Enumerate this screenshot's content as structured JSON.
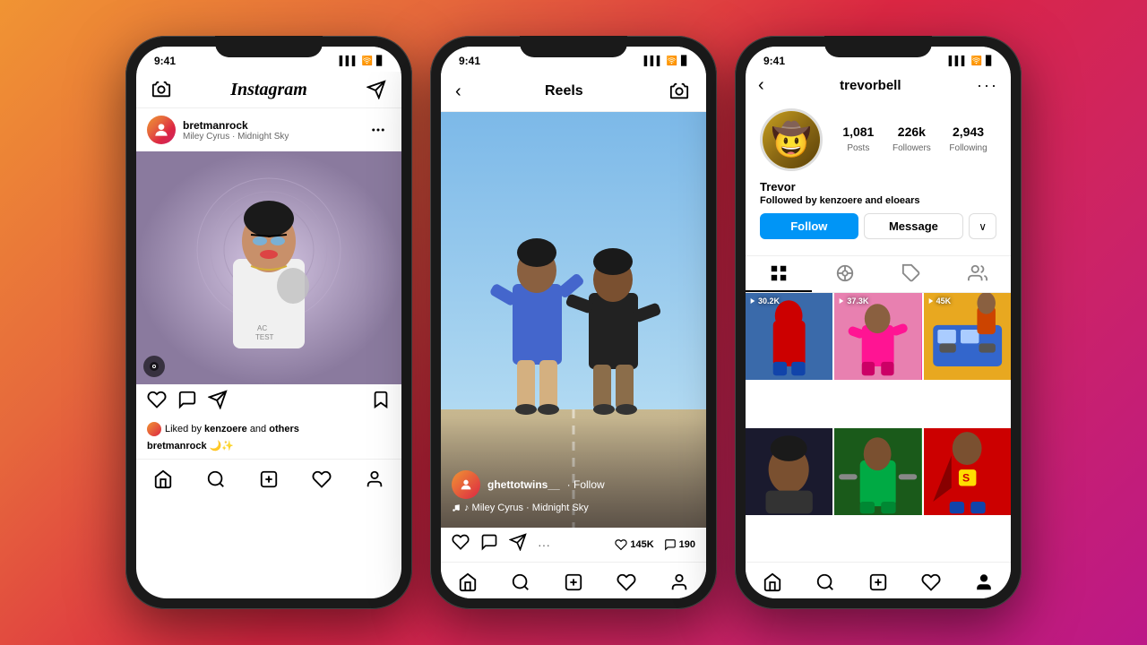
{
  "phone1": {
    "statusTime": "9:41",
    "header": {
      "logo": "Instagram",
      "cameraIcon": "📷",
      "sendIcon": "✈"
    },
    "post": {
      "username": "bretmanrock",
      "subtitle": "Miley Cyrus · Midnight Sky",
      "moreIcon": "···",
      "musicBadge": "♪",
      "likedBy": "Liked by",
      "likedByUser": "kenzoere",
      "likedByAnd": "and",
      "likedByOthers": "others",
      "caption": "bretmanrock",
      "captionEmoji": "🌙✨"
    },
    "nav": [
      "🏠",
      "🔍",
      "➕",
      "♡",
      "👤"
    ]
  },
  "phone2": {
    "statusTime": "9:41",
    "header": {
      "backIcon": "‹",
      "title": "Reels",
      "cameraIcon": "📷"
    },
    "reel": {
      "avatar": "👤",
      "username": "ghettotwins__",
      "followText": "· Follow",
      "song": "♪ Miley Cyrus · Midnight Sky",
      "likes": "145K",
      "comments": "190"
    },
    "nav": [
      "🏠",
      "🔍",
      "➕",
      "♡",
      "👤"
    ]
  },
  "phone3": {
    "statusTime": "9:41",
    "header": {
      "backIcon": "‹",
      "username": "trevorbell",
      "moreIcon": "···"
    },
    "profile": {
      "avatarEmoji": "🤠",
      "stats": {
        "posts": "1,081",
        "postsLabel": "Posts",
        "followers": "226k",
        "followersLabel": "Followers",
        "following": "2,943",
        "followingLabel": "Following"
      },
      "name": "Trevor",
      "followedByText": "Followed by",
      "followedByUser1": "kenzoere",
      "followedByAnd": "and",
      "followedByUser2": "eloears",
      "buttons": {
        "follow": "Follow",
        "message": "Message",
        "chevron": "∨"
      },
      "gridItems": [
        {
          "count": "30.2K",
          "color": "gi-1"
        },
        {
          "count": "37.3K",
          "color": "gi-2"
        },
        {
          "count": "45K",
          "color": "gi-3"
        },
        {
          "count": "",
          "color": "gi-4"
        },
        {
          "count": "",
          "color": "gi-5"
        },
        {
          "count": "",
          "color": "gi-6"
        }
      ]
    },
    "nav": [
      "🏠",
      "🔍",
      "➕",
      "♡",
      "👤"
    ]
  }
}
